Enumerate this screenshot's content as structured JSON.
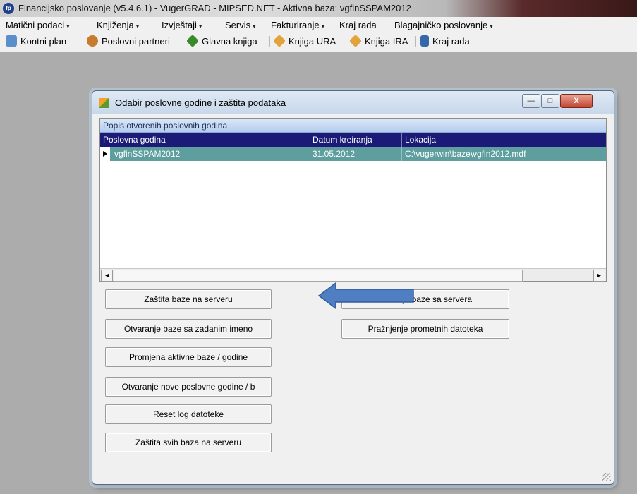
{
  "app": {
    "icon_text": "fp",
    "title": "Financijsko poslovanje (v5.4.6.1) - VugerGRAD - MIPSED.NET - Aktivna baza: vgfinSSPAM2012"
  },
  "menu": [
    {
      "label": "Matični podaci",
      "arrow": "▾"
    },
    {
      "label": "Knjiženja",
      "arrow": "▾"
    },
    {
      "label": "Izvještaji",
      "arrow": "▾"
    },
    {
      "label": "Servis",
      "arrow": "▾"
    },
    {
      "label": "Fakturiranje",
      "arrow": "▾"
    },
    {
      "label": "Kraj rada",
      "arrow": ""
    },
    {
      "label": "Blagajničko poslovanje",
      "arrow": "▾"
    }
  ],
  "toolbar": [
    {
      "label": "Kontni plan",
      "icon": "chart-icon",
      "color": "#5b8fc9"
    },
    {
      "label": "Poslovni partneri",
      "icon": "people-icon",
      "color": "#c87b2c"
    },
    {
      "label": "Glavna knjiga",
      "icon": "book-green-icon",
      "color": "#3a8a2c"
    },
    {
      "label": "Knjiga URA",
      "icon": "book-orange-icon",
      "color": "#e3a23b"
    },
    {
      "label": "Knjiga IRA",
      "icon": "book-orange-icon",
      "color": "#e3a23b"
    },
    {
      "label": "Kraj rada",
      "icon": "exit-door-icon",
      "color": "#3568a8"
    }
  ],
  "dialog": {
    "title": "Odabir poslovne godine i zaštita podataka",
    "controls": {
      "minimize": "—",
      "maximize": "□",
      "close": "X"
    },
    "grid": {
      "caption": "Popis otvorenih poslovnih godina",
      "columns": [
        "Poslovna godina",
        "Datum kreiranja",
        "Lokacija"
      ],
      "rows": [
        {
          "godina": "vgfinSSPAM2012",
          "datum": "31.05.2012",
          "lokacija": "C:\\vugerwin\\baze\\vgfin2012.mdf"
        }
      ],
      "scroll_left": "◂",
      "scroll_right": "▸"
    },
    "buttons_left": [
      "Zaštita baze na serveru",
      "Otvaranje baze sa zadanim imeno",
      "Promjena aktivne baze / godine",
      "Otvaranje nove poslovne godine / b",
      "Reset log datoteke",
      "Zaštita svih baza na serveru"
    ],
    "buttons_right": [
      "Brisanje baze sa servera",
      "Pražnjenje prometnih datoteka"
    ]
  },
  "colors": {
    "header_bg": "#1b1b77",
    "selected_row_bg": "#5e9e9e",
    "annotation_arrow": "#4f7fc2"
  }
}
